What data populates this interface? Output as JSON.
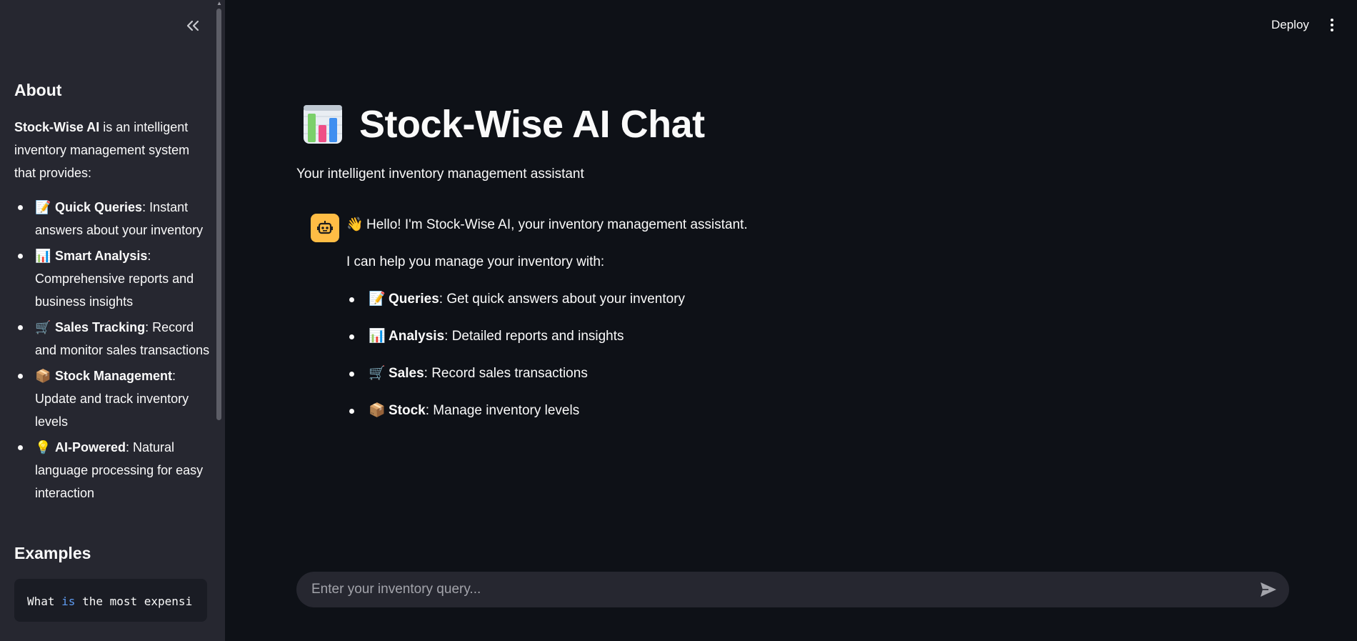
{
  "header": {
    "deploy_label": "Deploy"
  },
  "sidebar": {
    "about_heading": "About",
    "intro_strong": "Stock-Wise AI",
    "intro_rest": " is an intelligent inventory management system that provides:",
    "features": [
      {
        "icon": "memo-icon",
        "emoji": "📝",
        "name": "Quick Queries",
        "desc": ": Instant answers about your inventory"
      },
      {
        "icon": "bar-chart-icon",
        "emoji": "📊",
        "name": "Smart Analysis",
        "desc": ": Comprehensive reports and business insights"
      },
      {
        "icon": "cart-icon",
        "emoji": "🛒",
        "name": "Sales Tracking",
        "desc": ": Record and monitor sales transactions"
      },
      {
        "icon": "package-icon",
        "emoji": "📦",
        "name": "Stock Management",
        "desc": ": Update and track inventory levels"
      },
      {
        "icon": "bulb-icon",
        "emoji": "💡",
        "name": "AI-Powered",
        "desc": ": Natural language processing for easy interaction"
      }
    ],
    "examples_heading": "Examples",
    "example_code_pre": "What ",
    "example_code_kw": "is",
    "example_code_post": " the most expensi"
  },
  "main": {
    "title_emoji": "📊",
    "title": "Stock-Wise AI Chat",
    "subtitle": "Your intelligent inventory management assistant"
  },
  "chat": {
    "greeting_emoji": "👋",
    "greeting": "Hello! I'm Stock-Wise AI, your inventory management assistant.",
    "help_line": "I can help you manage your inventory with:",
    "capabilities": [
      {
        "icon": "memo-icon",
        "emoji": "📝",
        "name": "Queries",
        "desc": ": Get quick answers about your inventory"
      },
      {
        "icon": "bar-chart-icon",
        "emoji": "📊",
        "name": "Analysis",
        "desc": ": Detailed reports and insights"
      },
      {
        "icon": "cart-icon",
        "emoji": "🛒",
        "name": "Sales",
        "desc": ": Record sales transactions"
      },
      {
        "icon": "package-icon",
        "emoji": "📦",
        "name": "Stock",
        "desc": ": Manage inventory levels"
      }
    ],
    "input_placeholder": "Enter your inventory query...",
    "input_value": ""
  },
  "colors": {
    "background": "#0e1117",
    "sidebar": "#262730",
    "avatar": "#ffbd45",
    "text": "#fafafa"
  }
}
